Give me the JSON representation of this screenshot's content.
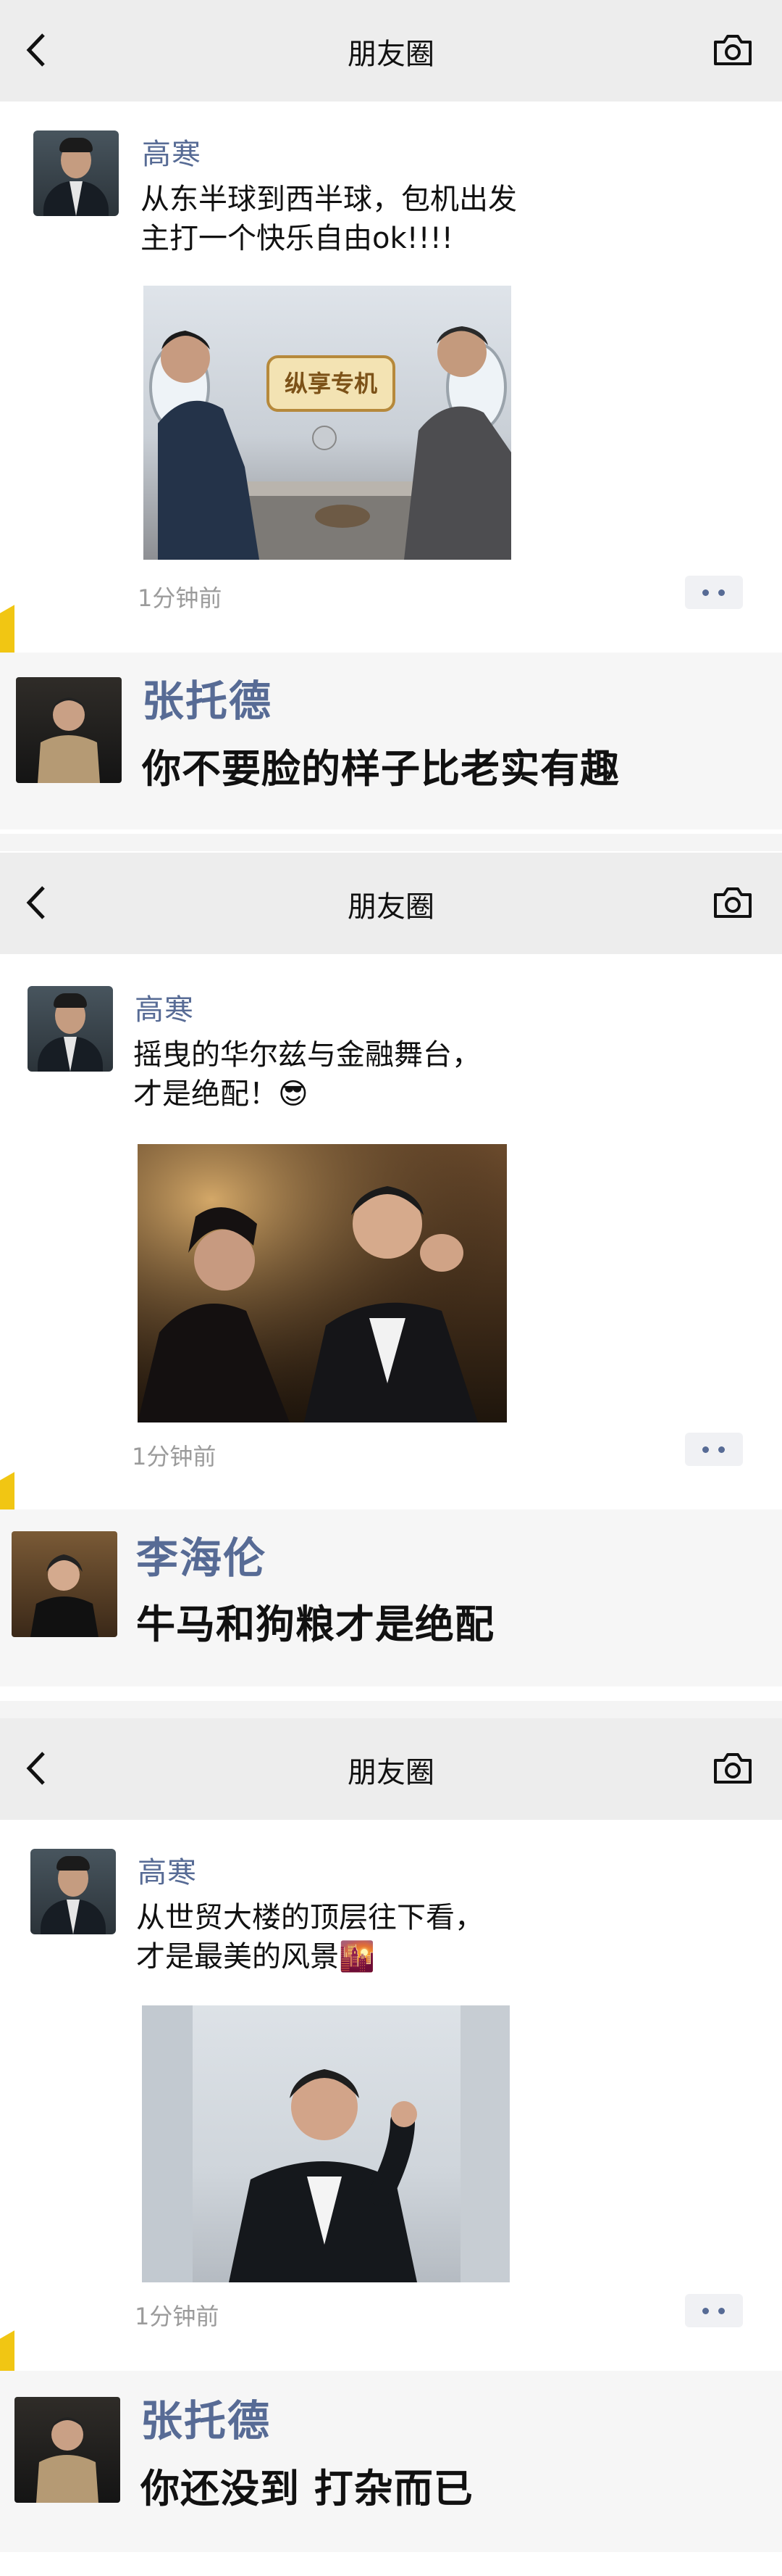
{
  "screen_title": "朋友圈",
  "panels": [
    {
      "poster_name": "高寒",
      "post_text": "从东半球到西半球，包机出发\n主打一个快乐自由ok!!!!",
      "time": "1分钟前",
      "photo_sign": "纵享专机",
      "commenter_name": "张托德",
      "comment_text": "你不要脸的样子比老实有趣"
    },
    {
      "poster_name": "高寒",
      "post_text": "摇曳的华尔兹与金融舞台，\n才是绝配！😎",
      "time": "1分钟前",
      "commenter_name": "李海伦",
      "comment_text": "牛马和狗粮才是绝配"
    },
    {
      "poster_name": "高寒",
      "post_text": "从世贸大楼的顶层往下看，\n才是最美的风景🌇",
      "time": "1分钟前",
      "commenter_name": "张托德",
      "comment_text": "你还没到 打杂而已"
    }
  ],
  "icons": {
    "back": "chevron-left-icon",
    "camera": "camera-icon",
    "more": "more-dots-icon"
  },
  "colors": {
    "navbar_bg": "#ededed",
    "name_link": "#576b95",
    "time_gray": "#9b9b9b",
    "comment_bg": "#f6f6f6"
  }
}
